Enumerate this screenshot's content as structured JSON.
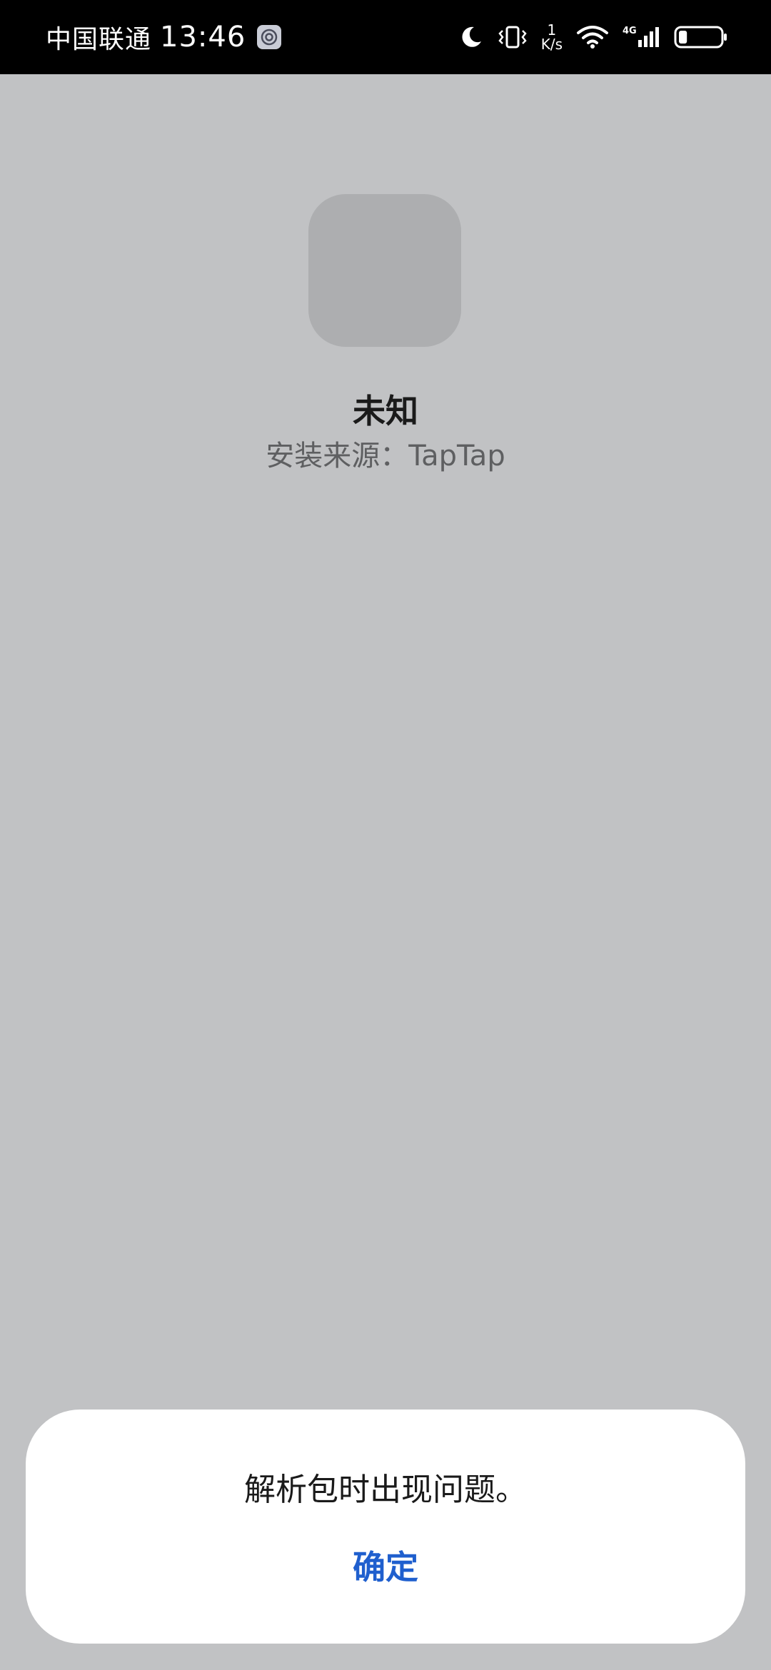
{
  "status_bar": {
    "carrier": "中国联通",
    "time": "13:46",
    "net_speed_value": "1",
    "net_speed_unit": "K/s",
    "network_type": "4G",
    "icons": [
      "app-notification-icon",
      "moon-icon",
      "vibrate-icon",
      "wifi-icon",
      "cellular-signal-icon",
      "battery-icon"
    ],
    "battery_level": 0.2
  },
  "app": {
    "name": "未知",
    "source": "安装来源：TapTap"
  },
  "dialog": {
    "message": "解析包时出现问题。",
    "confirm_label": "确定"
  },
  "colors": {
    "background": "#c1c2c4",
    "status_bar": "#000000",
    "app_icon_placeholder": "#adaeb0",
    "dialog_background": "#ffffff",
    "accent": "#1f5fce"
  }
}
